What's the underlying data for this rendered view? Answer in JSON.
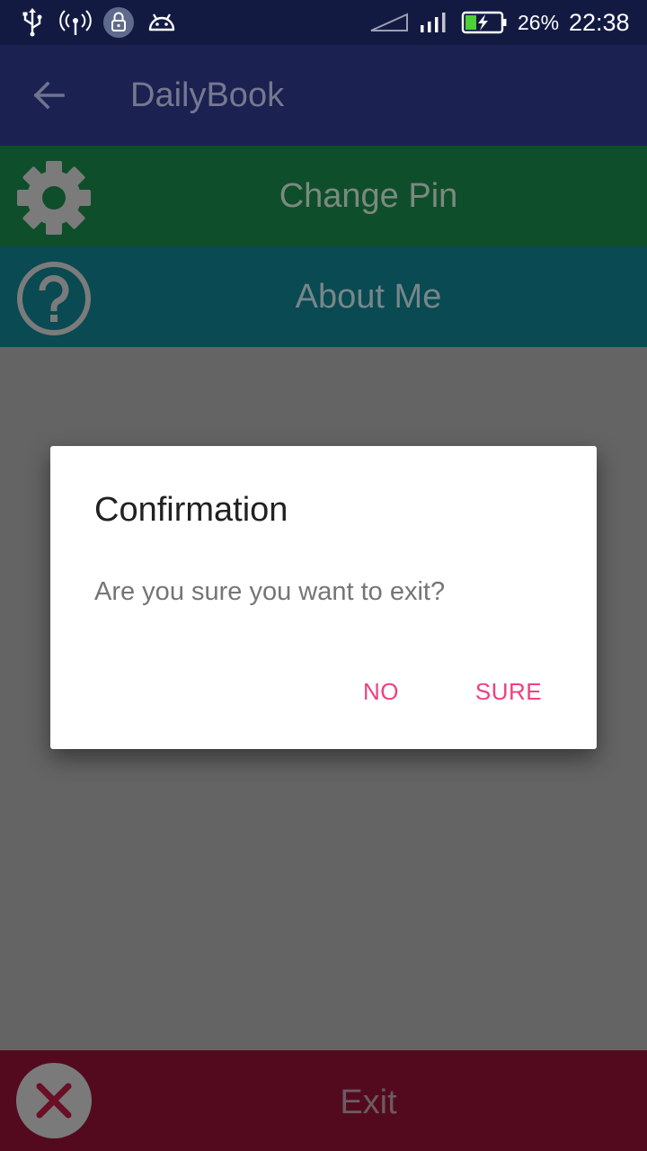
{
  "status_bar": {
    "icons_left": [
      "usb-icon",
      "hotspot-icon",
      "vpn-lock-icon",
      "android-debug-icon"
    ],
    "icons_right": [
      "no-signal-icon",
      "signal-bars-icon",
      "battery-charging-icon"
    ],
    "battery_percent": "26%",
    "time": "22:38"
  },
  "app_bar": {
    "title": "DailyBook",
    "back_icon": "arrow-back-icon"
  },
  "menu": {
    "items": [
      {
        "label": "Change Pin",
        "icon": "gear-icon",
        "color": "#0f4e2b"
      },
      {
        "label": "About Me",
        "icon": "help-circle-icon",
        "color": "#0a4a52"
      }
    ]
  },
  "exit_bar": {
    "label": "Exit",
    "icon": "close-icon",
    "color": "#530a1f"
  },
  "dialog": {
    "title": "Confirmation",
    "message": "Are you sure you want to exit?",
    "buttons": {
      "no": "NO",
      "sure": "SURE"
    },
    "accent": "#ef3f7f"
  }
}
